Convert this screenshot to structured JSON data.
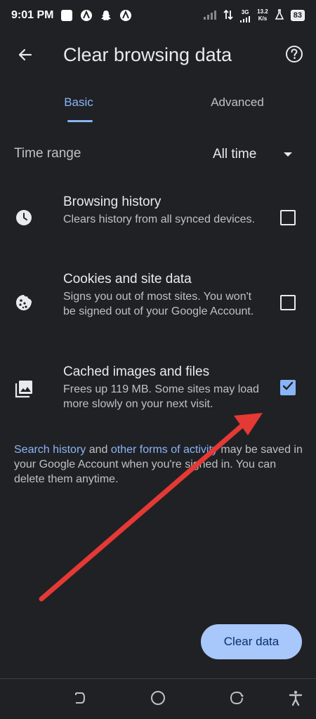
{
  "status_bar": {
    "time": "9:01 PM",
    "network": "3G",
    "speed_value": "13.2",
    "speed_unit": "K/s",
    "battery": "83"
  },
  "app_bar": {
    "title": "Clear browsing data",
    "back_icon": "arrow-back-icon",
    "help_icon": "help-circle-icon"
  },
  "tabs": [
    {
      "label": "Basic",
      "selected": true
    },
    {
      "label": "Advanced",
      "selected": false
    }
  ],
  "time_range": {
    "label": "Time range",
    "value": "All time"
  },
  "options": [
    {
      "icon": "clock-icon",
      "title": "Browsing history",
      "description": "Clears history from all synced devices.",
      "checked": false
    },
    {
      "icon": "cookie-icon",
      "title": "Cookies and site data",
      "description": "Signs you out of most sites. You won't be signed out of your Google Account.",
      "checked": false
    },
    {
      "icon": "image-stack-icon",
      "title": "Cached images and files",
      "description": "Frees up 119 MB. Some sites may load more slowly on your next visit.",
      "checked": true
    }
  ],
  "note": {
    "link1": "Search history",
    "text1": " and ",
    "link2": "other forms of activity",
    "text2": " may be saved in your Google Account when you're signed in. You can delete them anytime."
  },
  "clear_button": "Clear data",
  "colors": {
    "background": "#202124",
    "accent": "#8ab4f8",
    "button": "#a8c7fa",
    "annotation_arrow": "#e53935"
  }
}
